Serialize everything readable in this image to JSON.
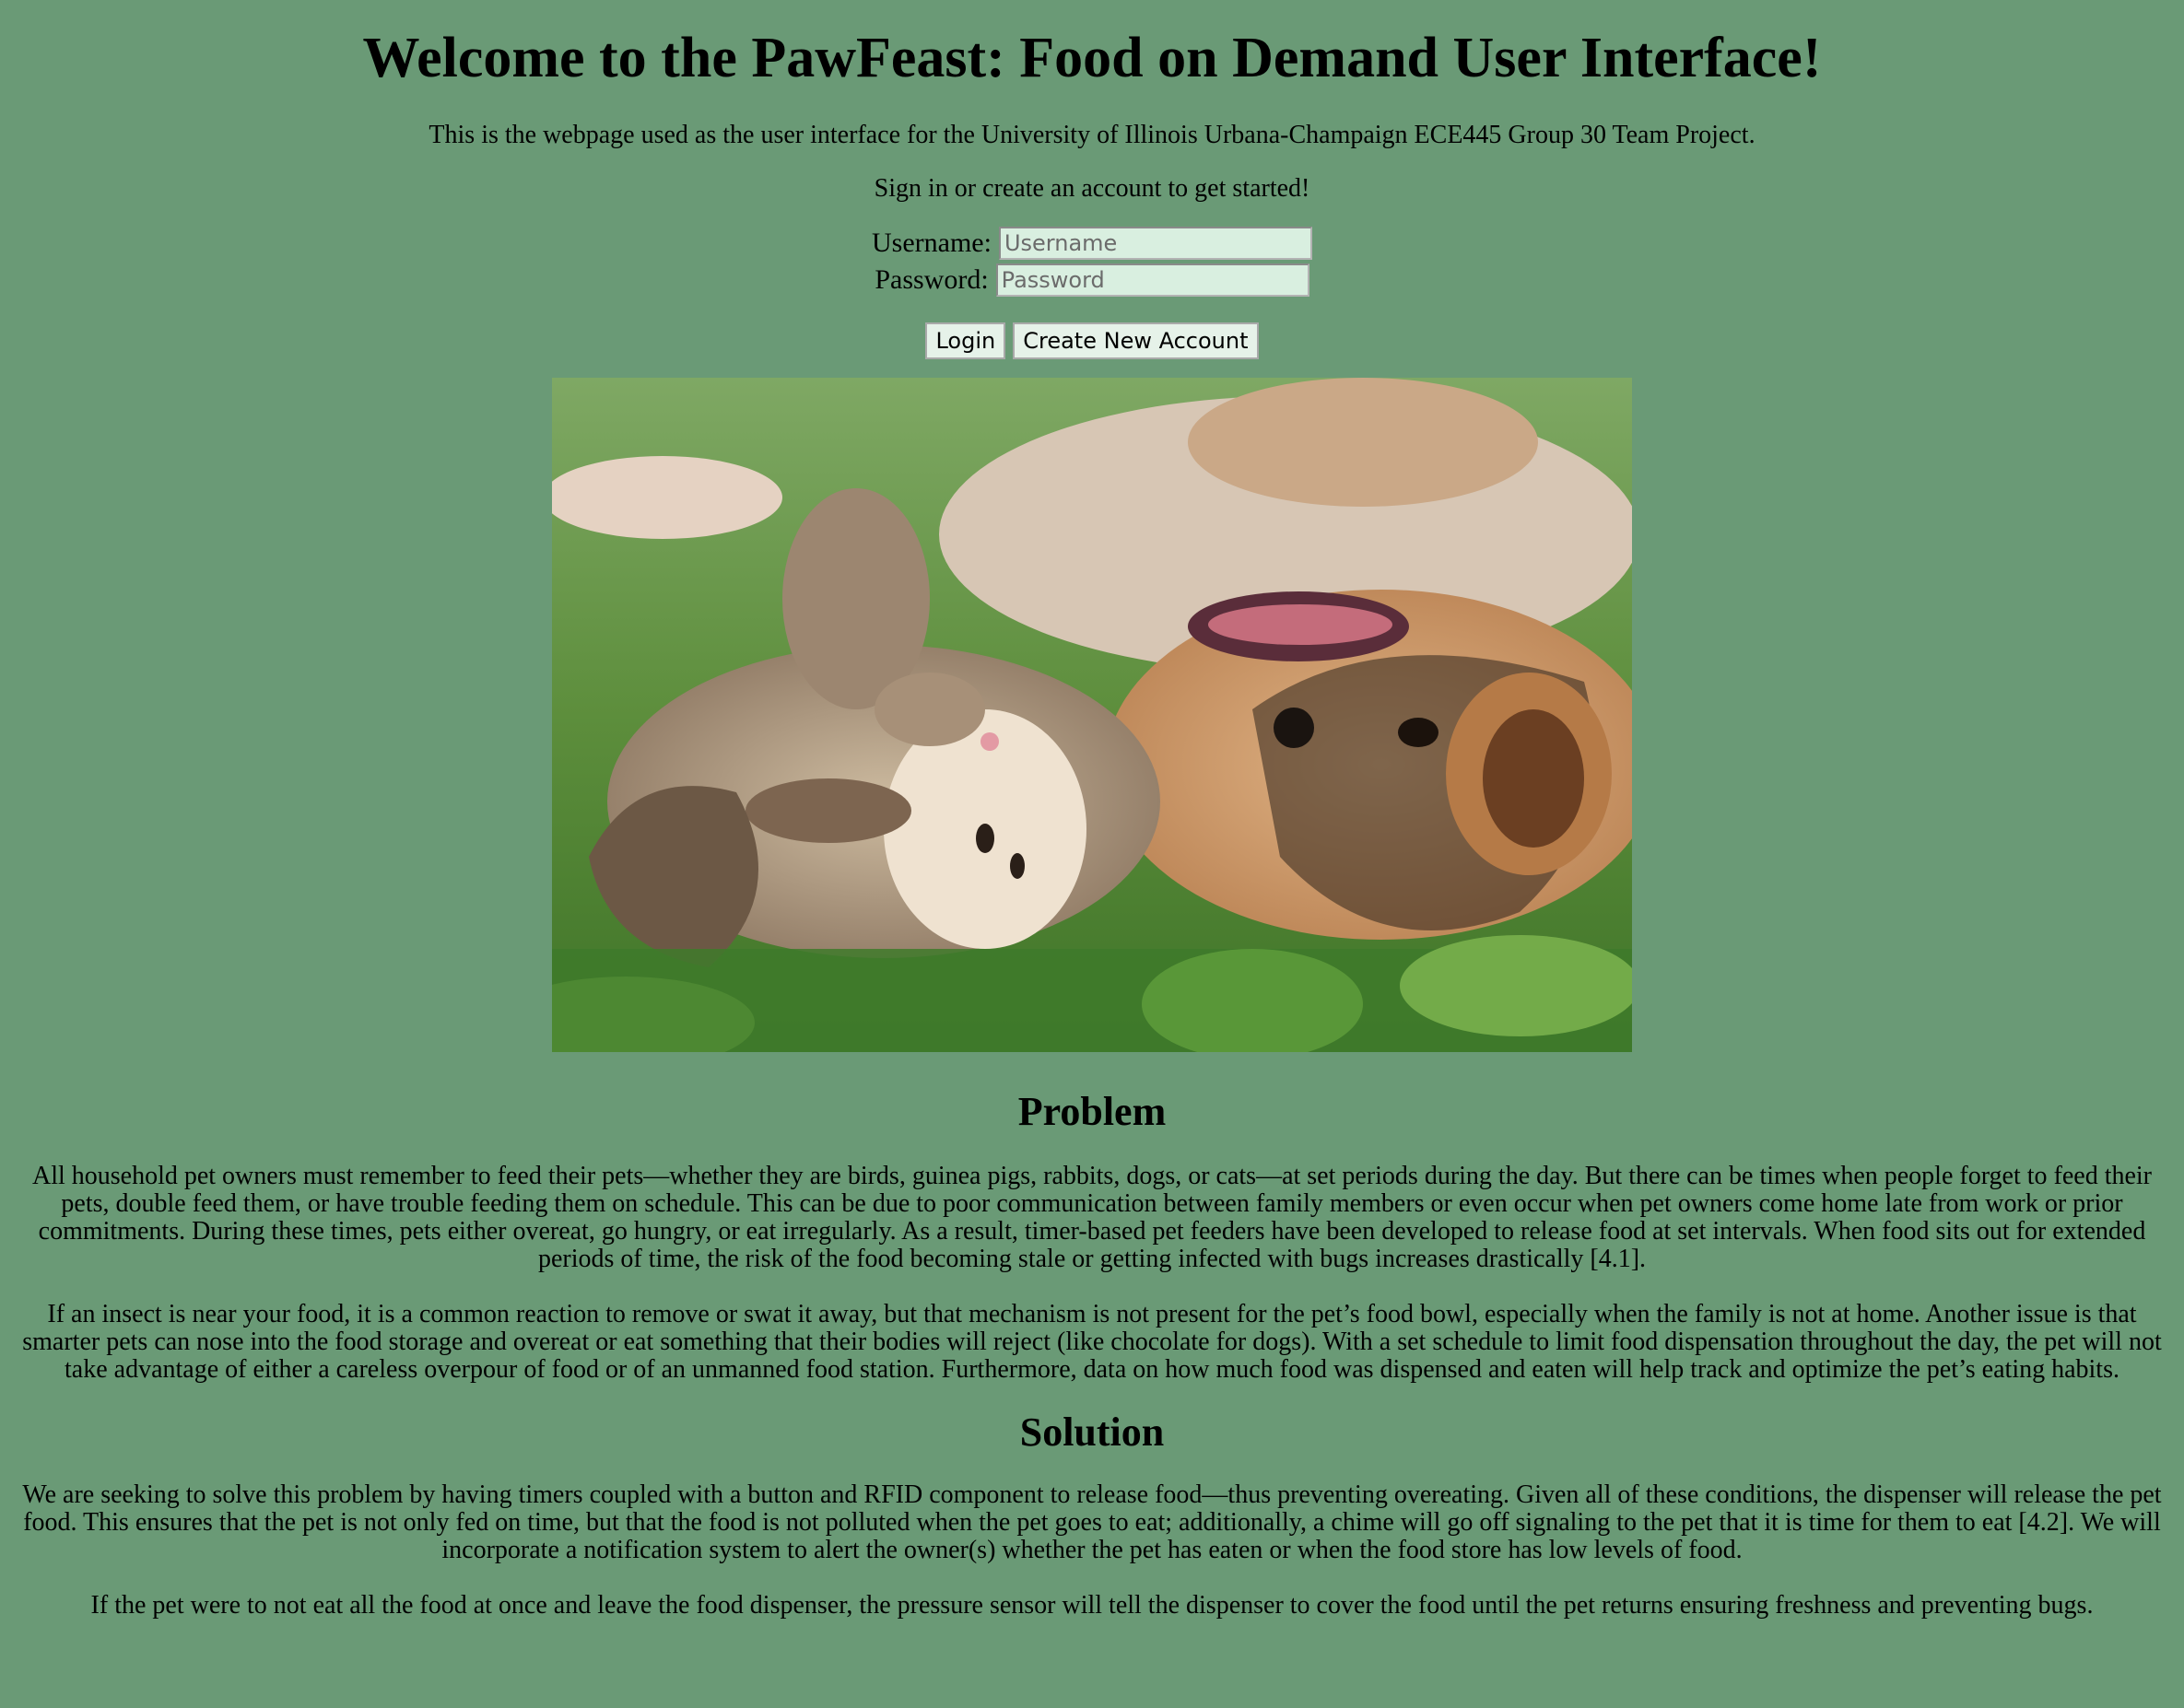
{
  "header": {
    "title": "Welcome to the PawFeast: Food on Demand User Interface!",
    "intro": "This is the webpage used as the user interface for the University of Illinois Urbana-Champaign ECE445 Group 30 Team Project.",
    "signin_prompt": "Sign in or create an account to get started!"
  },
  "login_form": {
    "username_label": "Username:",
    "username_placeholder": "Username",
    "username_value": "",
    "password_label": "Password:",
    "password_placeholder": "Password",
    "password_value": "",
    "login_button": "Login",
    "create_account_button": "Create New Account"
  },
  "hero_image": {
    "subject": "cat-and-dog-lying-in-grass"
  },
  "problem": {
    "heading": "Problem",
    "paragraphs": [
      "All household pet owners must remember to feed their pets—whether they are birds, guinea pigs, rabbits, dogs, or cats—at set periods during the day. But there can be times when people forget to feed their pets, double feed them, or have trouble feeding them on schedule. This can be due to poor communication between family members or even occur when pet owners come home late from work or prior commitments. During these times, pets either overeat, go hungry, or eat irregularly. As a result, timer-based pet feeders have been developed to release food at set intervals. When food sits out for extended periods of time, the risk of the food becoming stale or getting infected with bugs increases drastically [4.1].",
      "If an insect is near your food, it is a common reaction to remove or swat it away, but that mechanism is not present for the pet’s food bowl, especially when the family is not at home. Another issue is that smarter pets can nose into the food storage and overeat or eat something that their bodies will reject (like chocolate for dogs). With a set schedule to limit food dispensation throughout the day, the pet will not take advantage of either a careless overpour of food or of an unmanned food station. Furthermore, data on how much food was dispensed and eaten will help track and optimize the pet’s eating habits."
    ]
  },
  "solution": {
    "heading": "Solution",
    "paragraphs": [
      "We are seeking to solve this problem by having timers coupled with a button and RFID component to release food—thus preventing overeating. Given all of these conditions, the dispenser will release the pet food. This ensures that the pet is not only fed on time, but that the food is not polluted when the pet goes to eat; additionally, a chime will go off signaling to the pet that it is time for them to eat [4.2]. We will incorporate a notification system to alert the owner(s) whether the pet has eaten or when the food store has low levels of food.",
      "If the pet were to not eat all the food at once and leave the food dispenser, the pressure sensor will tell the dispenser to cover the food until the pet returns ensuring freshness and preventing bugs."
    ]
  },
  "colors": {
    "page_background": "#6a9a76",
    "input_background": "#d9efe0",
    "button_background": "#e6f2e9"
  }
}
